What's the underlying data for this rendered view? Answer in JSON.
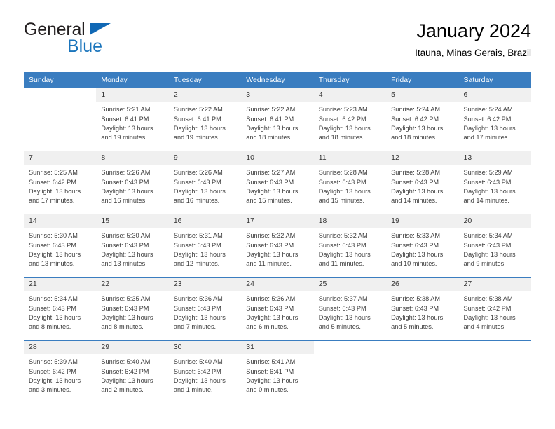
{
  "logo": {
    "general": "General",
    "blue": "Blue",
    "triangle_color": "#1068b5"
  },
  "header": {
    "title": "January 2024",
    "location": "Itauna, Minas Gerais, Brazil"
  },
  "theme": {
    "header_bg": "#3a7dc0",
    "header_text": "#ffffff",
    "daynum_bg": "#f0f0f0",
    "separator": "#3a7dc0"
  },
  "weekdays": [
    "Sunday",
    "Monday",
    "Tuesday",
    "Wednesday",
    "Thursday",
    "Friday",
    "Saturday"
  ],
  "weeks": [
    [
      {
        "day": ""
      },
      {
        "day": "1",
        "sunrise": "Sunrise: 5:21 AM",
        "sunset": "Sunset: 6:41 PM",
        "daylight1": "Daylight: 13 hours",
        "daylight2": "and 19 minutes."
      },
      {
        "day": "2",
        "sunrise": "Sunrise: 5:22 AM",
        "sunset": "Sunset: 6:41 PM",
        "daylight1": "Daylight: 13 hours",
        "daylight2": "and 19 minutes."
      },
      {
        "day": "3",
        "sunrise": "Sunrise: 5:22 AM",
        "sunset": "Sunset: 6:41 PM",
        "daylight1": "Daylight: 13 hours",
        "daylight2": "and 18 minutes."
      },
      {
        "day": "4",
        "sunrise": "Sunrise: 5:23 AM",
        "sunset": "Sunset: 6:42 PM",
        "daylight1": "Daylight: 13 hours",
        "daylight2": "and 18 minutes."
      },
      {
        "day": "5",
        "sunrise": "Sunrise: 5:24 AM",
        "sunset": "Sunset: 6:42 PM",
        "daylight1": "Daylight: 13 hours",
        "daylight2": "and 18 minutes."
      },
      {
        "day": "6",
        "sunrise": "Sunrise: 5:24 AM",
        "sunset": "Sunset: 6:42 PM",
        "daylight1": "Daylight: 13 hours",
        "daylight2": "and 17 minutes."
      }
    ],
    [
      {
        "day": "7",
        "sunrise": "Sunrise: 5:25 AM",
        "sunset": "Sunset: 6:42 PM",
        "daylight1": "Daylight: 13 hours",
        "daylight2": "and 17 minutes."
      },
      {
        "day": "8",
        "sunrise": "Sunrise: 5:26 AM",
        "sunset": "Sunset: 6:43 PM",
        "daylight1": "Daylight: 13 hours",
        "daylight2": "and 16 minutes."
      },
      {
        "day": "9",
        "sunrise": "Sunrise: 5:26 AM",
        "sunset": "Sunset: 6:43 PM",
        "daylight1": "Daylight: 13 hours",
        "daylight2": "and 16 minutes."
      },
      {
        "day": "10",
        "sunrise": "Sunrise: 5:27 AM",
        "sunset": "Sunset: 6:43 PM",
        "daylight1": "Daylight: 13 hours",
        "daylight2": "and 15 minutes."
      },
      {
        "day": "11",
        "sunrise": "Sunrise: 5:28 AM",
        "sunset": "Sunset: 6:43 PM",
        "daylight1": "Daylight: 13 hours",
        "daylight2": "and 15 minutes."
      },
      {
        "day": "12",
        "sunrise": "Sunrise: 5:28 AM",
        "sunset": "Sunset: 6:43 PM",
        "daylight1": "Daylight: 13 hours",
        "daylight2": "and 14 minutes."
      },
      {
        "day": "13",
        "sunrise": "Sunrise: 5:29 AM",
        "sunset": "Sunset: 6:43 PM",
        "daylight1": "Daylight: 13 hours",
        "daylight2": "and 14 minutes."
      }
    ],
    [
      {
        "day": "14",
        "sunrise": "Sunrise: 5:30 AM",
        "sunset": "Sunset: 6:43 PM",
        "daylight1": "Daylight: 13 hours",
        "daylight2": "and 13 minutes."
      },
      {
        "day": "15",
        "sunrise": "Sunrise: 5:30 AM",
        "sunset": "Sunset: 6:43 PM",
        "daylight1": "Daylight: 13 hours",
        "daylight2": "and 13 minutes."
      },
      {
        "day": "16",
        "sunrise": "Sunrise: 5:31 AM",
        "sunset": "Sunset: 6:43 PM",
        "daylight1": "Daylight: 13 hours",
        "daylight2": "and 12 minutes."
      },
      {
        "day": "17",
        "sunrise": "Sunrise: 5:32 AM",
        "sunset": "Sunset: 6:43 PM",
        "daylight1": "Daylight: 13 hours",
        "daylight2": "and 11 minutes."
      },
      {
        "day": "18",
        "sunrise": "Sunrise: 5:32 AM",
        "sunset": "Sunset: 6:43 PM",
        "daylight1": "Daylight: 13 hours",
        "daylight2": "and 11 minutes."
      },
      {
        "day": "19",
        "sunrise": "Sunrise: 5:33 AM",
        "sunset": "Sunset: 6:43 PM",
        "daylight1": "Daylight: 13 hours",
        "daylight2": "and 10 minutes."
      },
      {
        "day": "20",
        "sunrise": "Sunrise: 5:34 AM",
        "sunset": "Sunset: 6:43 PM",
        "daylight1": "Daylight: 13 hours",
        "daylight2": "and 9 minutes."
      }
    ],
    [
      {
        "day": "21",
        "sunrise": "Sunrise: 5:34 AM",
        "sunset": "Sunset: 6:43 PM",
        "daylight1": "Daylight: 13 hours",
        "daylight2": "and 8 minutes."
      },
      {
        "day": "22",
        "sunrise": "Sunrise: 5:35 AM",
        "sunset": "Sunset: 6:43 PM",
        "daylight1": "Daylight: 13 hours",
        "daylight2": "and 8 minutes."
      },
      {
        "day": "23",
        "sunrise": "Sunrise: 5:36 AM",
        "sunset": "Sunset: 6:43 PM",
        "daylight1": "Daylight: 13 hours",
        "daylight2": "and 7 minutes."
      },
      {
        "day": "24",
        "sunrise": "Sunrise: 5:36 AM",
        "sunset": "Sunset: 6:43 PM",
        "daylight1": "Daylight: 13 hours",
        "daylight2": "and 6 minutes."
      },
      {
        "day": "25",
        "sunrise": "Sunrise: 5:37 AM",
        "sunset": "Sunset: 6:43 PM",
        "daylight1": "Daylight: 13 hours",
        "daylight2": "and 5 minutes."
      },
      {
        "day": "26",
        "sunrise": "Sunrise: 5:38 AM",
        "sunset": "Sunset: 6:43 PM",
        "daylight1": "Daylight: 13 hours",
        "daylight2": "and 5 minutes."
      },
      {
        "day": "27",
        "sunrise": "Sunrise: 5:38 AM",
        "sunset": "Sunset: 6:42 PM",
        "daylight1": "Daylight: 13 hours",
        "daylight2": "and 4 minutes."
      }
    ],
    [
      {
        "day": "28",
        "sunrise": "Sunrise: 5:39 AM",
        "sunset": "Sunset: 6:42 PM",
        "daylight1": "Daylight: 13 hours",
        "daylight2": "and 3 minutes."
      },
      {
        "day": "29",
        "sunrise": "Sunrise: 5:40 AM",
        "sunset": "Sunset: 6:42 PM",
        "daylight1": "Daylight: 13 hours",
        "daylight2": "and 2 minutes."
      },
      {
        "day": "30",
        "sunrise": "Sunrise: 5:40 AM",
        "sunset": "Sunset: 6:42 PM",
        "daylight1": "Daylight: 13 hours",
        "daylight2": "and 1 minute."
      },
      {
        "day": "31",
        "sunrise": "Sunrise: 5:41 AM",
        "sunset": "Sunset: 6:41 PM",
        "daylight1": "Daylight: 13 hours",
        "daylight2": "and 0 minutes."
      },
      {
        "day": ""
      },
      {
        "day": ""
      },
      {
        "day": ""
      }
    ]
  ]
}
